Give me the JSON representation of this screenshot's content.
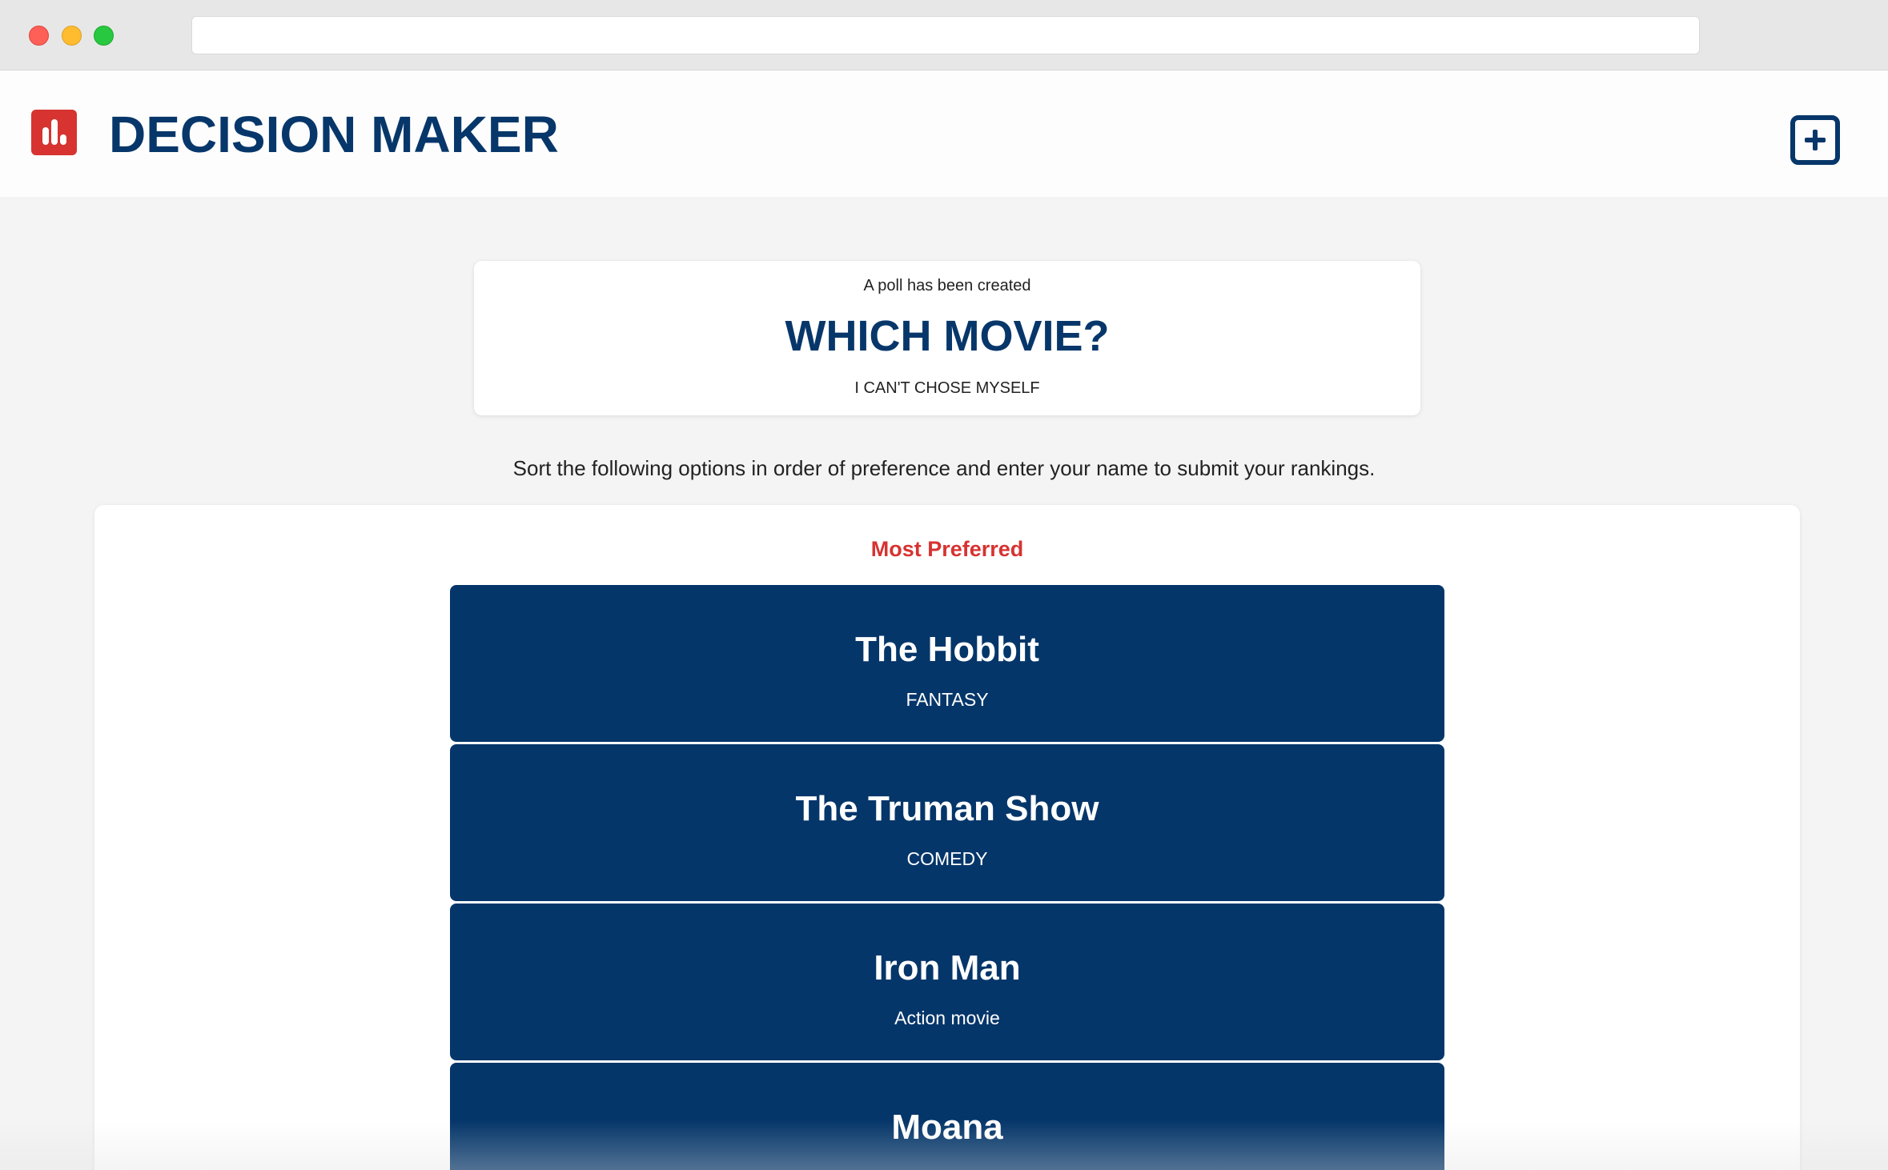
{
  "browser": {
    "url": ""
  },
  "header": {
    "brand_title": "DECISION MAKER",
    "logo_icon": "bar-chart-icon",
    "add_icon": "plus-square-icon"
  },
  "poll": {
    "created_message": "A poll has been created",
    "title": "WHICH MOVIE?",
    "description": "I CAN'T CHOSE MYSELF"
  },
  "instructions": "Sort the following options in order of preference and enter your name to submit your rankings.",
  "ranking": {
    "top_label": "Most Preferred",
    "options": [
      {
        "title": "The Hobbit",
        "category": "FANTASY"
      },
      {
        "title": "The Truman Show",
        "category": "COMEDY"
      },
      {
        "title": "Iron Man",
        "category": "Action movie"
      },
      {
        "title": "Moana",
        "category": ""
      }
    ]
  },
  "colors": {
    "primary": "#07376a",
    "accent": "#d63331",
    "background": "#f4f4f4"
  }
}
